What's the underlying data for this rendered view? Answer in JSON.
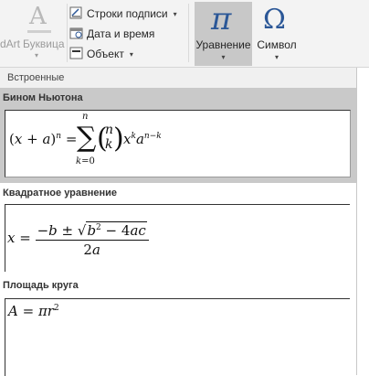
{
  "ribbon": {
    "wordart_label": "dArt",
    "bukvica_label": "Буквица",
    "commands": [
      {
        "label": "Строки подписи",
        "icon": "signature-line-icon"
      },
      {
        "label": "Дата и время",
        "icon": "calendar-icon"
      },
      {
        "label": "Объект",
        "icon": "object-icon"
      }
    ],
    "equation_label": "Уравнение",
    "symbol_label": "Символ",
    "equation_glyph": "π",
    "symbol_glyph": "Ω",
    "dropdown_glyph": "▾",
    "accent_color": "#2b5797"
  },
  "gallery": {
    "section_title": "Встроенные",
    "items": [
      {
        "title": "Бином Ньютона",
        "formula": "(x + a)^n = Σ_{k=0}^{n} (n k) x^k a^{n−k}",
        "selected": true
      },
      {
        "title": "Квадратное уравнение",
        "formula": "x = (−b ± √(b^2 − 4ac)) / 2a",
        "selected": false
      },
      {
        "title": "Площадь круга",
        "formula": "A = πr^2",
        "selected": false
      }
    ]
  }
}
